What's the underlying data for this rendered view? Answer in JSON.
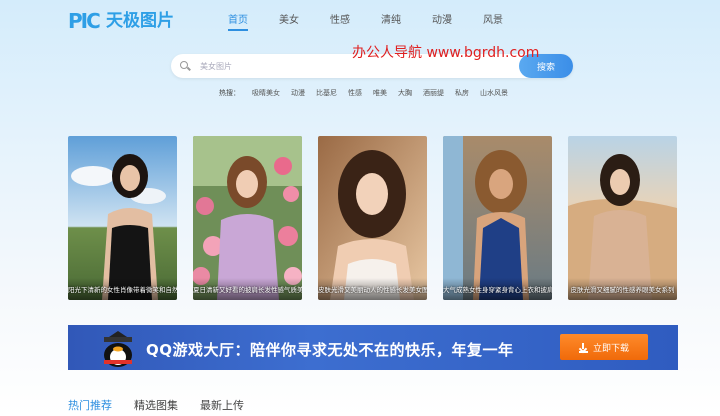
{
  "logo": {
    "mark": "PIC",
    "text": "天极图片"
  },
  "nav": [
    "首页",
    "美女",
    "性感",
    "清纯",
    "动漫",
    "风景"
  ],
  "search": {
    "placeholder": "美女图片",
    "button": "搜索"
  },
  "watermark": "办公人导航 www.bgrdh.com",
  "hot": {
    "label": "热搜：",
    "items": [
      "吸睛美女",
      "动漫",
      "比基尼",
      "性感",
      "唯美",
      "大胸",
      "酒丽缇",
      "私房",
      "山水风景"
    ]
  },
  "cards": [
    {
      "title": "阳光下清新的女性肖像带着微笑和自然妆容"
    },
    {
      "title": "夏日清新又好看的披肩长发性感气质美女"
    },
    {
      "title": "皮肤光滑又美丽动人的性感长发美女图片"
    },
    {
      "title": "大气成熟女性身穿紧身背心上衣和披肩长发"
    },
    {
      "title": "皮肤光滑又细腻的性感养眼美女系列"
    }
  ],
  "banner": {
    "text": "QQ游戏大厅：陪伴你寻求无处不在的快乐，年复一年",
    "button": "立即下载"
  },
  "tabs": [
    "热门推荐",
    "精选图集",
    "最新上传"
  ],
  "colors": {
    "accent": "#2e8fe0",
    "watermark": "#e02020",
    "banner_bg": "#3158b8",
    "download_btn": "#f47a1a"
  }
}
